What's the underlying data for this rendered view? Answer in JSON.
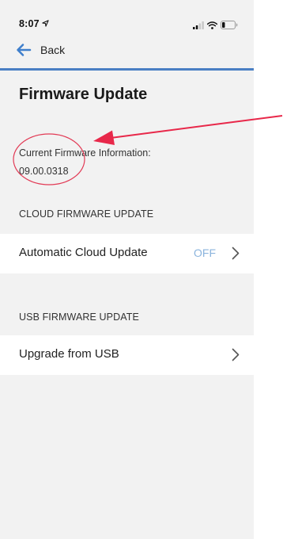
{
  "status_bar": {
    "time": "8:07",
    "location_icon": "location-arrow-icon",
    "signal_icon": "cellular-signal-icon",
    "wifi_icon": "wifi-icon",
    "battery_icon": "battery-icon"
  },
  "nav": {
    "back_label": "Back",
    "back_icon": "arrow-left-icon"
  },
  "page": {
    "title": "Firmware Update"
  },
  "firmware_info": {
    "label": "Current Firmware Information:",
    "version": "09.00.0318"
  },
  "cloud_section": {
    "header": "CLOUD FIRMWARE UPDATE",
    "automatic_update": {
      "label": "Automatic Cloud Update",
      "value": "OFF"
    }
  },
  "usb_section": {
    "header": "USB FIRMWARE UPDATE",
    "upgrade": {
      "label": "Upgrade from USB"
    }
  },
  "colors": {
    "accent": "#4a7fc4",
    "value_text": "#8bb4dd",
    "annotation": "#e8284a",
    "background": "#f2f2f2"
  }
}
